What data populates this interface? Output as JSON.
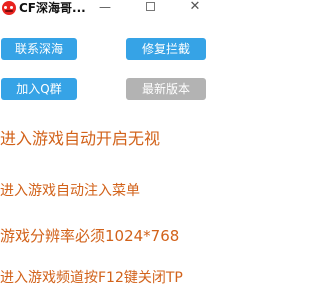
{
  "window": {
    "title": "CF深海哥...",
    "minimize_glyph": "—",
    "close_glyph": "✕",
    "icon": "red-cartoon-face-icon"
  },
  "buttons": {
    "contact": "联系深海",
    "repair": "修复拦截",
    "join": "加入Q群",
    "latest": "最新版本"
  },
  "colors": {
    "button_blue": "#36a3e6",
    "button_disabled": "#b3b3b3",
    "notice_text": "#d2621a"
  },
  "notices": [
    "进入游戏自动开启无视",
    "进入游戏自动注入菜单",
    "游戏分辨率必须1024*768",
    "进入游戏频道按F12键关闭TP"
  ]
}
